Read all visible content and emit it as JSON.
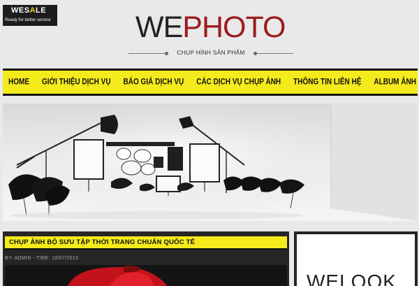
{
  "badge": {
    "brand_pre": "WES",
    "brand_accent": "A",
    "brand_post": "LE",
    "tagline": "Ready for better service"
  },
  "logo": {
    "we": "WE",
    "photo": "PHOTO",
    "tagline": "CHỤP HÌNH SẢN PHẨM"
  },
  "nav": {
    "items": [
      "HOME",
      "GIỚI THIỆU DỊCH VỤ",
      "BÁO GIÁ DỊCH VỤ",
      "CÁC DỊCH VỤ CHỤP ẢNH",
      "THÔNG TIN LIÊN HỆ",
      "ALBUM ẢNH"
    ]
  },
  "post": {
    "title": "CHỤP ẢNH BỘ SƯU TẬP THỜI TRANG CHUẨN QUỐC TẾ",
    "meta": "BY: ADMIN - TIME: 10/07/2013"
  },
  "sidebar": {
    "ad_text": "WELOOK"
  },
  "colors": {
    "accent_yellow": "#f5eb1c",
    "brand_red": "#9b1b1e",
    "dark": "#262626"
  }
}
